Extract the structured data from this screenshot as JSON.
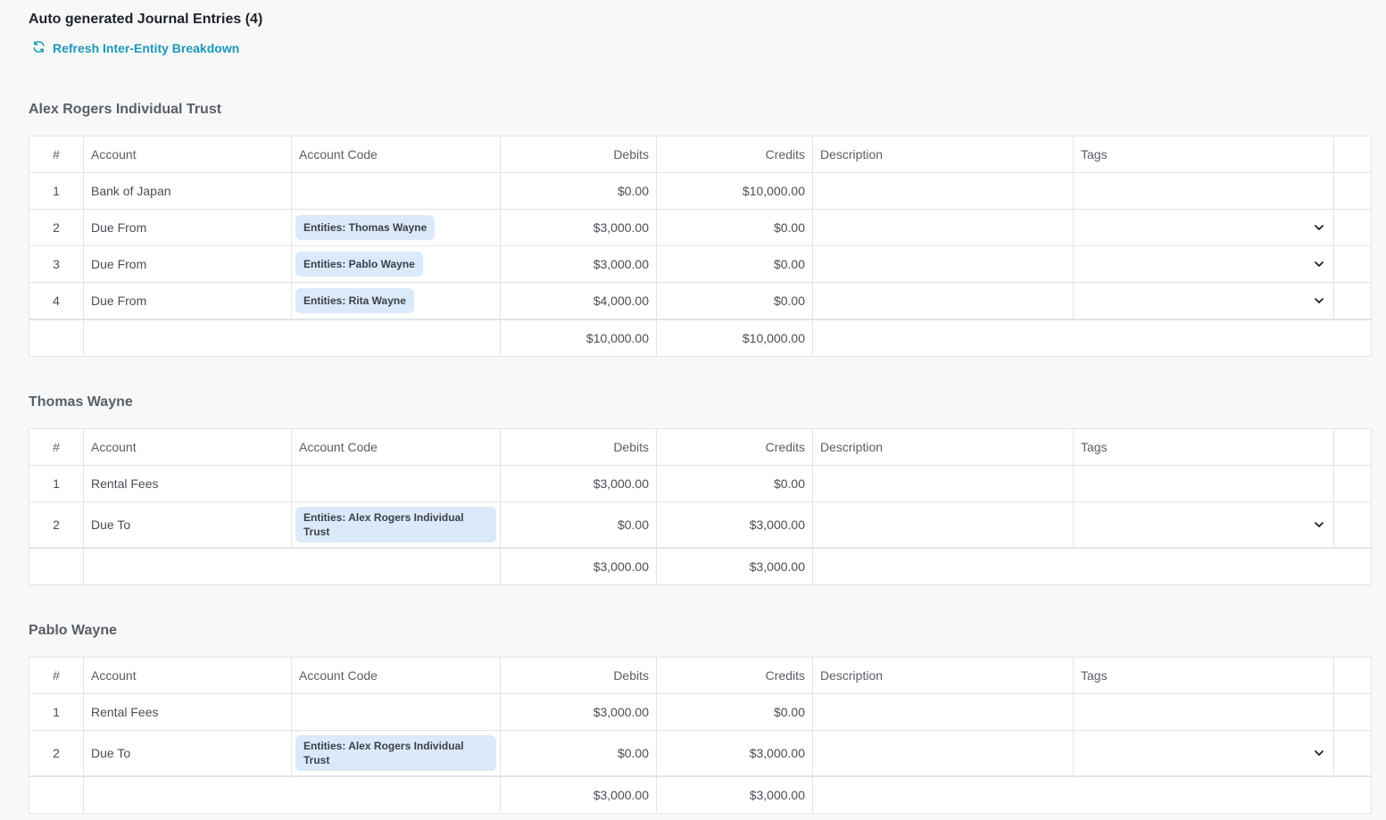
{
  "page": {
    "title": "Auto generated Journal Entries (4)",
    "refresh_label": "Refresh Inter-Entity Breakdown"
  },
  "columns": {
    "num": "#",
    "account": "Account",
    "account_code": "Account Code",
    "debits": "Debits",
    "credits": "Credits",
    "description": "Description",
    "tags": "Tags"
  },
  "sections": [
    {
      "title": "Alex Rogers Individual Trust",
      "rows": [
        {
          "num": "1",
          "account": "Bank of Japan",
          "code": "",
          "debits": "$0.00",
          "credits": "$10,000.00"
        },
        {
          "num": "2",
          "account": "Due From",
          "code": "Entities: Thomas Wayne",
          "debits": "$3,000.00",
          "credits": "$0.00"
        },
        {
          "num": "3",
          "account": "Due From",
          "code": "Entities: Pablo Wayne",
          "debits": "$3,000.00",
          "credits": "$0.00"
        },
        {
          "num": "4",
          "account": "Due From",
          "code": "Entities: Rita Wayne",
          "debits": "$4,000.00",
          "credits": "$0.00"
        }
      ],
      "total": {
        "debits": "$10,000.00",
        "credits": "$10,000.00"
      }
    },
    {
      "title": "Thomas Wayne",
      "rows": [
        {
          "num": "1",
          "account": "Rental Fees",
          "code": "",
          "debits": "$3,000.00",
          "credits": "$0.00"
        },
        {
          "num": "2",
          "account": "Due To",
          "code": "Entities: Alex Rogers Individual Trust",
          "debits": "$0.00",
          "credits": "$3,000.00"
        }
      ],
      "total": {
        "debits": "$3,000.00",
        "credits": "$3,000.00"
      }
    },
    {
      "title": "Pablo Wayne",
      "rows": [
        {
          "num": "1",
          "account": "Rental Fees",
          "code": "",
          "debits": "$3,000.00",
          "credits": "$0.00"
        },
        {
          "num": "2",
          "account": "Due To",
          "code": "Entities: Alex Rogers Individual Trust",
          "debits": "$0.00",
          "credits": "$3,000.00"
        }
      ],
      "total": {
        "debits": "$3,000.00",
        "credits": "$3,000.00"
      }
    }
  ],
  "icons": {
    "refresh": "refresh-icon",
    "dropdown": "chevron-down-icon"
  },
  "colors": {
    "accent": "#1b98b6",
    "chip_bg": "#dbeafa"
  }
}
